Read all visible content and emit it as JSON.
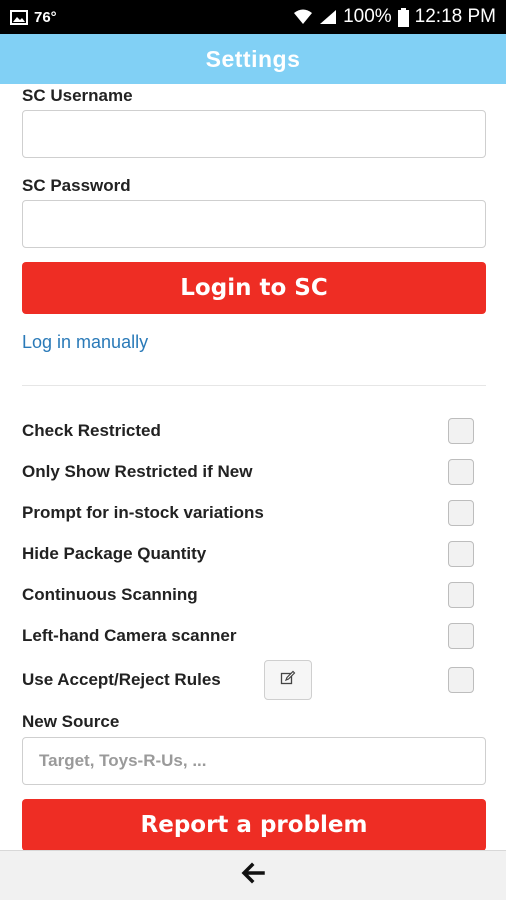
{
  "status_bar": {
    "temperature": "76°",
    "battery": "100%",
    "time": "12:18 PM",
    "icons": [
      "image-icon",
      "wifi-icon",
      "signal-icon",
      "battery-icon"
    ]
  },
  "header": {
    "title": "Settings",
    "color": "#81d0f5"
  },
  "form": {
    "username_label": "SC Username",
    "username_value": "",
    "password_label": "SC Password",
    "password_value": "",
    "login_button": "Login to SC",
    "manual_link": "Log in manually"
  },
  "options": [
    {
      "label": "Check Restricted",
      "checked": false
    },
    {
      "label": "Only Show Restricted if New",
      "checked": false
    },
    {
      "label": "Prompt for in-stock variations",
      "checked": false
    },
    {
      "label": "Hide Package Quantity",
      "checked": false
    },
    {
      "label": "Continuous Scanning",
      "checked": false
    },
    {
      "label": "Left-hand Camera scanner",
      "checked": false
    },
    {
      "label": "Use Accept/Reject Rules",
      "checked": false,
      "icon": "edit-icon"
    }
  ],
  "source": {
    "label": "New Source",
    "placeholder": "Target, Toys-R-Us, ...",
    "value": ""
  },
  "report_button": "Report a problem",
  "nav": {
    "icon": "back-arrow-icon"
  },
  "colors": {
    "accent_red": "#ee2d24",
    "link_blue": "#2a7ab8"
  }
}
